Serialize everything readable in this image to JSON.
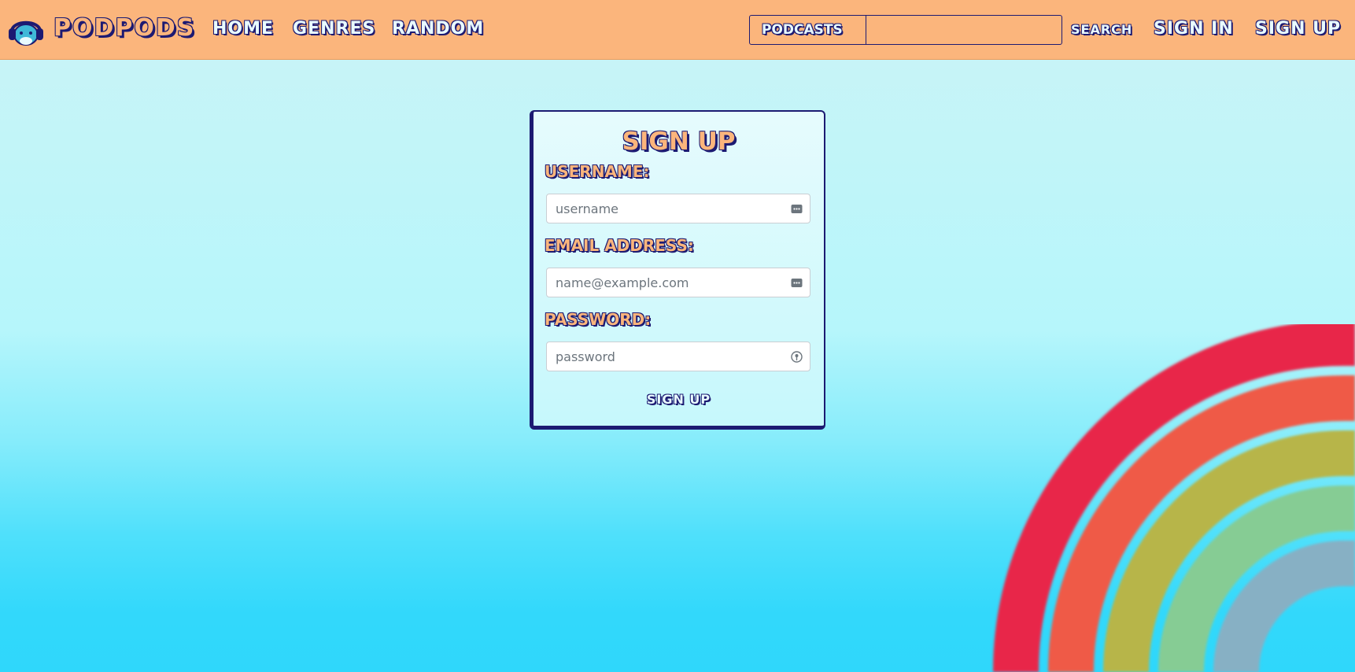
{
  "navbar": {
    "brand": "PODPODS",
    "links": [
      {
        "label": "HOME"
      },
      {
        "label": "GENRES"
      },
      {
        "label": "RANDOM"
      }
    ],
    "search": {
      "category": "PODCASTS",
      "query": "",
      "button": "SEARCH"
    },
    "sign_in": "SIGN IN",
    "sign_up": "SIGN UP"
  },
  "form": {
    "title": "SIGN UP",
    "username_label": "USERNAME:",
    "username_placeholder": "username",
    "email_label": "EMAIL ADDRESS:",
    "email_placeholder": "name@example.com",
    "password_label": "PASSWORD:",
    "password_placeholder": "password",
    "submit": "SIGN UP"
  },
  "icons": {
    "logo": "headphones-mascot-icon",
    "username_field": "password-manager-icon",
    "email_field": "password-manager-icon",
    "password_field": "key-icon"
  },
  "colors": {
    "navbar": "#fbb57c",
    "accent": "#1c1a72",
    "label_fill": "#fbb57c",
    "rainbow": [
      "#e8284a",
      "#ef5a47",
      "#b7b548",
      "#86cc94",
      "#87b0c4"
    ]
  }
}
